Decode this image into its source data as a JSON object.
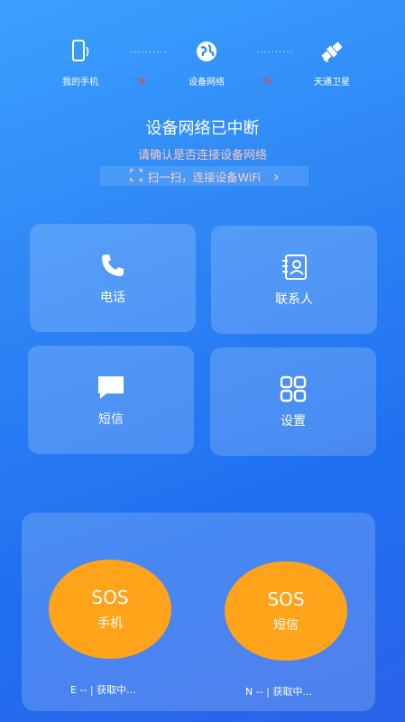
{
  "status": {
    "phone_label": "我的手机",
    "network_label": "设备网络",
    "satellite_label": "天通卫星",
    "dots": "··········",
    "x_mark": "✕"
  },
  "notice": {
    "title": "设备网络已中断",
    "subtitle": "请确认是否连接设备网络",
    "scan_text": "扫一扫，连接设备WiFi",
    "scan_arrow": "›"
  },
  "grid": {
    "phone": "电话",
    "contacts": "联系人",
    "sms": "短信",
    "settings": "设置"
  },
  "sos": {
    "sos_label": "SOS",
    "phone_label": "手机",
    "sms_label": "短信",
    "left_coord": "E -- | 获取中...",
    "right_coord": "N -- | 获取中..."
  },
  "colors": {
    "accent_orange": "#ffa31a",
    "error_red": "#ff3b3b"
  }
}
